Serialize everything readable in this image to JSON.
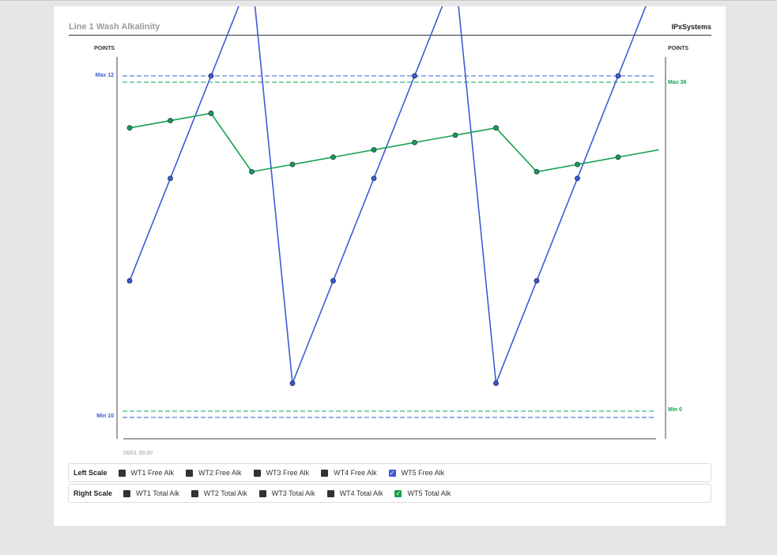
{
  "header": {
    "title": "Line 1 Wash Alkalinity",
    "brand": "IPxSystems"
  },
  "chart_data": {
    "type": "line",
    "left_axis": {
      "label": "POINTS",
      "max_label": "Max 12",
      "min_label": "Min 10",
      "limit_color": "#3d5bd6"
    },
    "right_axis": {
      "label": "POINTS",
      "max_label": "Max 36",
      "min_label": "Min 0",
      "limit_color": "#15a04e"
    },
    "x_tick_label": "06/01 00:00",
    "series": [
      {
        "name": "WT5 Free Alk",
        "axis": "left",
        "color": "#3d5bd6",
        "values": [
          10.8,
          11.4,
          12.0,
          12.6,
          10.2,
          10.8,
          11.4,
          12.0,
          12.6,
          10.2,
          10.8,
          11.4,
          12.0,
          12.6
        ]
      },
      {
        "name": "WT5 Total Alk",
        "axis": "right",
        "color": "#15a04e",
        "values": [
          31.0,
          31.8,
          32.6,
          26.2,
          27.0,
          27.8,
          28.6,
          29.4,
          30.2,
          31.0,
          26.2,
          27.0,
          27.8,
          28.6
        ]
      }
    ],
    "left_limits": {
      "max": 12,
      "min": 10
    },
    "right_limits": {
      "max": 36,
      "min": 0
    },
    "grid": false
  },
  "legend": {
    "left_scale_label": "Left Scale",
    "right_scale_label": "Right Scale",
    "left_items": [
      {
        "label": "WT1 Free Alk",
        "checked": false
      },
      {
        "label": "WT2 Free Alk",
        "checked": false
      },
      {
        "label": "WT3 Free Alk",
        "checked": false
      },
      {
        "label": "WT4 Free Alk",
        "checked": false
      },
      {
        "label": "WT5 Free Alk",
        "checked": true
      }
    ],
    "right_items": [
      {
        "label": "WT1 Total Alk",
        "checked": false
      },
      {
        "label": "WT2 Total Alk",
        "checked": false
      },
      {
        "label": "WT3 Total Alk",
        "checked": false
      },
      {
        "label": "WT4 Total Alk",
        "checked": false
      },
      {
        "label": "WT5 Total Alk",
        "checked": true
      }
    ],
    "check_glyph": "✓",
    "colors": {
      "blue": "#3d5bd6",
      "green": "#15a04e",
      "unchecked": "#333333"
    }
  }
}
